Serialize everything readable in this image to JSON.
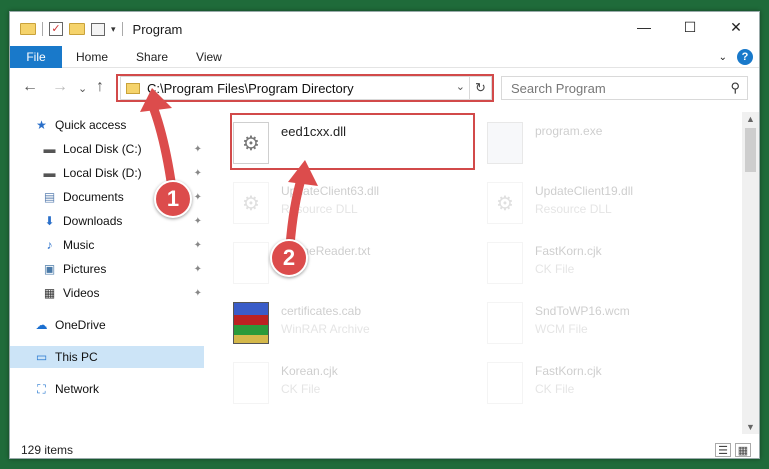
{
  "window": {
    "title": "Program",
    "controls": {
      "minimize": "—",
      "maximize": "☐",
      "close": "✕"
    }
  },
  "ribbon": {
    "file": "File",
    "tabs": [
      "Home",
      "Share",
      "View"
    ],
    "expand": "⌄",
    "help": "?"
  },
  "nav": {
    "back": "←",
    "forward": "→",
    "recent": "⌄",
    "up": "↑",
    "address": "C:\\Program Files\\Program Directory",
    "address_drop": "⌄",
    "refresh": "↻",
    "search_placeholder": "Search Program",
    "search_glyph": "⚲"
  },
  "sidebar": {
    "items": [
      {
        "label": "Quick access",
        "icon": "star-icon",
        "glyph": "★",
        "color": "#2a6fc9",
        "pinned": false
      },
      {
        "label": "Local Disk (C:)",
        "icon": "drive-icon",
        "glyph": "▬",
        "color": "#555",
        "pinned": true
      },
      {
        "label": "Local Disk (D:)",
        "icon": "drive-icon",
        "glyph": "▬",
        "color": "#555",
        "pinned": true
      },
      {
        "label": "Documents",
        "icon": "documents-icon",
        "glyph": "▤",
        "color": "#5a7fb0",
        "pinned": true
      },
      {
        "label": "Downloads",
        "icon": "download-icon",
        "glyph": "⬇",
        "color": "#2a6fc9",
        "pinned": true
      },
      {
        "label": "Music",
        "icon": "music-icon",
        "glyph": "♪",
        "color": "#2a6fc9",
        "pinned": true
      },
      {
        "label": "Pictures",
        "icon": "pictures-icon",
        "glyph": "▣",
        "color": "#4a7aa8",
        "pinned": true
      },
      {
        "label": "Videos",
        "icon": "video-icon",
        "glyph": "▦",
        "color": "#333",
        "pinned": true
      },
      {
        "label": "OneDrive",
        "icon": "cloud-icon",
        "glyph": "☁",
        "color": "#1b6fd0",
        "pinned": false
      },
      {
        "label": "This PC",
        "icon": "computer-icon",
        "glyph": "▭",
        "color": "#2a7ad0",
        "pinned": false
      },
      {
        "label": "Network",
        "icon": "network-icon",
        "glyph": "⛶",
        "color": "#2a7ad0",
        "pinned": false
      }
    ],
    "pin_glyph": "📌"
  },
  "files": [
    {
      "name": "eed1cxx.dll",
      "type": "",
      "icon": "dll-gear-icon",
      "dimmed": false
    },
    {
      "name": "program.exe",
      "type": "",
      "icon": "exe-icon",
      "dimmed": true
    },
    {
      "name": "UpdateClient63.dll",
      "type": "Resource DLL",
      "icon": "dll-gear-icon",
      "dimmed": true
    },
    {
      "name": "UpdateClient19.dll",
      "type": "Resource DLL",
      "icon": "dll-gear-icon",
      "dimmed": true
    },
    {
      "name": "OnlineReader.txt",
      "type": "File",
      "icon": "text-file-icon",
      "dimmed": true
    },
    {
      "name": "FastKorn.cjk",
      "type": "CK File",
      "icon": "blank-file-icon",
      "dimmed": true
    },
    {
      "name": "certificates.cab",
      "type": "WinRAR Archive",
      "icon": "winrar-icon",
      "dimmed": true
    },
    {
      "name": "SndToWP16.wcm",
      "type": "WCM File",
      "icon": "blank-file-icon",
      "dimmed": true
    },
    {
      "name": "Korean.cjk",
      "type": "CK File",
      "icon": "blank-file-icon",
      "dimmed": true
    },
    {
      "name": "FastKorn.cjk",
      "type": "CK File",
      "icon": "blank-file-icon",
      "dimmed": true
    }
  ],
  "status": {
    "items": "129 items"
  },
  "view_icons": {
    "details": "☰",
    "tiles": "▦"
  },
  "callouts": {
    "one": "1",
    "two": "2",
    "color": "#dc4c4c"
  }
}
